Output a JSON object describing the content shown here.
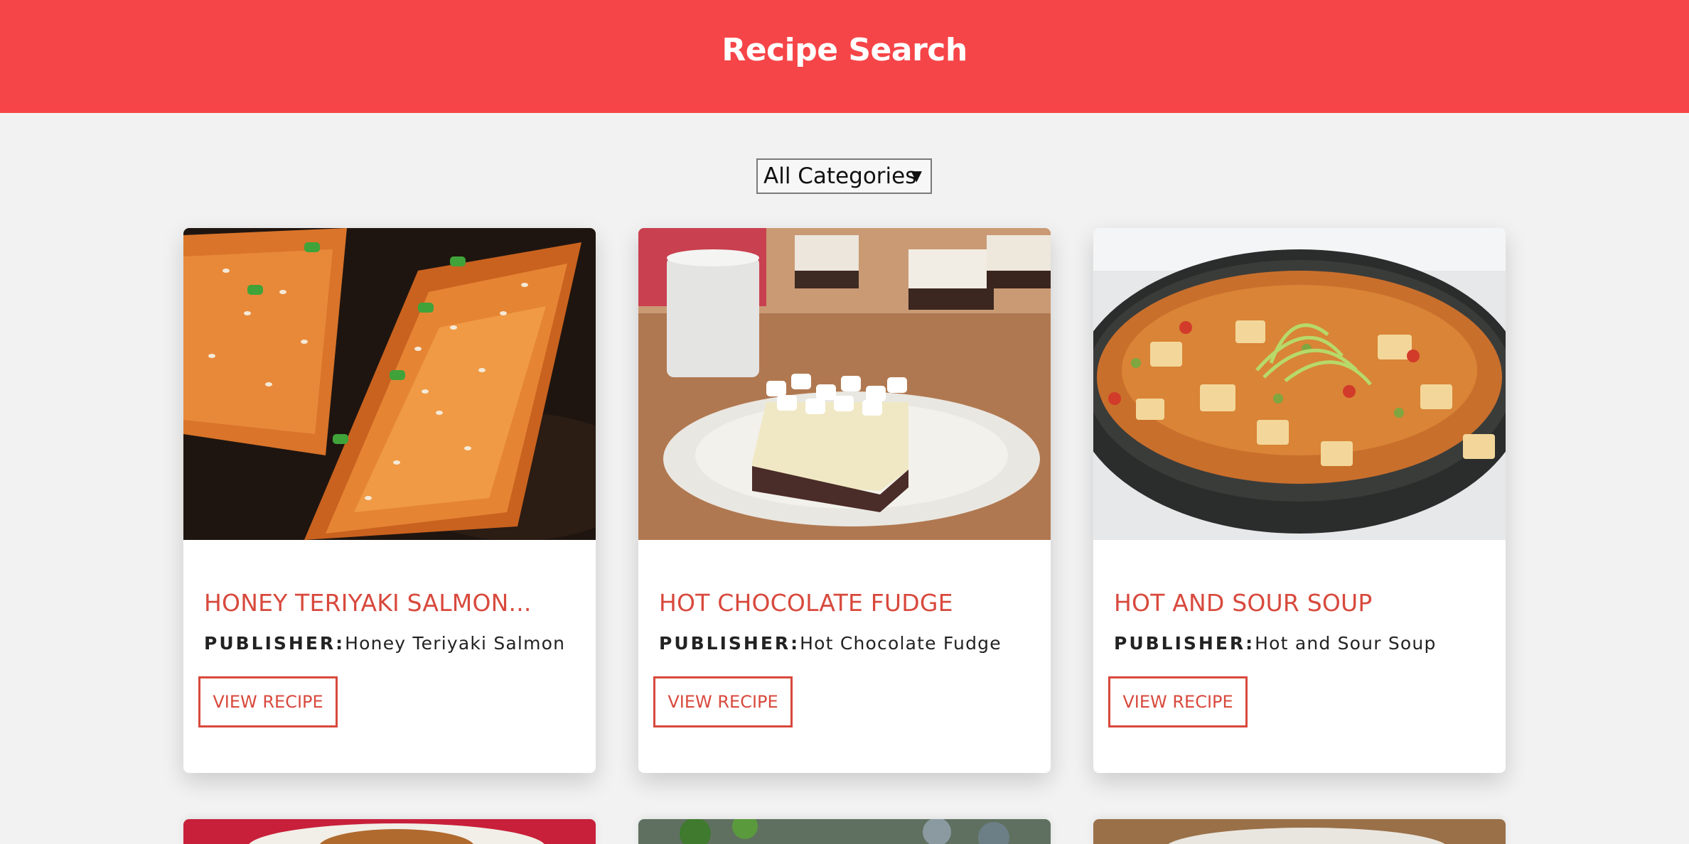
{
  "header": {
    "title": "Recipe Search",
    "background": "#f64548"
  },
  "filter": {
    "selected": "All Categories",
    "caret": "▼"
  },
  "accent_color": "#d8493d",
  "recipes": [
    {
      "title": "HONEY TERIYAKI SALMON...",
      "publisher_label": "PUBLISHER:",
      "publisher": "Honey Teriyaki Salmon",
      "button": "VIEW RECIPE"
    },
    {
      "title": "HOT CHOCOLATE FUDGE",
      "publisher_label": "PUBLISHER:",
      "publisher": "Hot Chocolate Fudge",
      "button": "VIEW RECIPE"
    },
    {
      "title": "HOT AND SOUR SOUP",
      "publisher_label": "PUBLISHER:",
      "publisher": "Hot and Sour Soup",
      "button": "VIEW RECIPE"
    }
  ]
}
